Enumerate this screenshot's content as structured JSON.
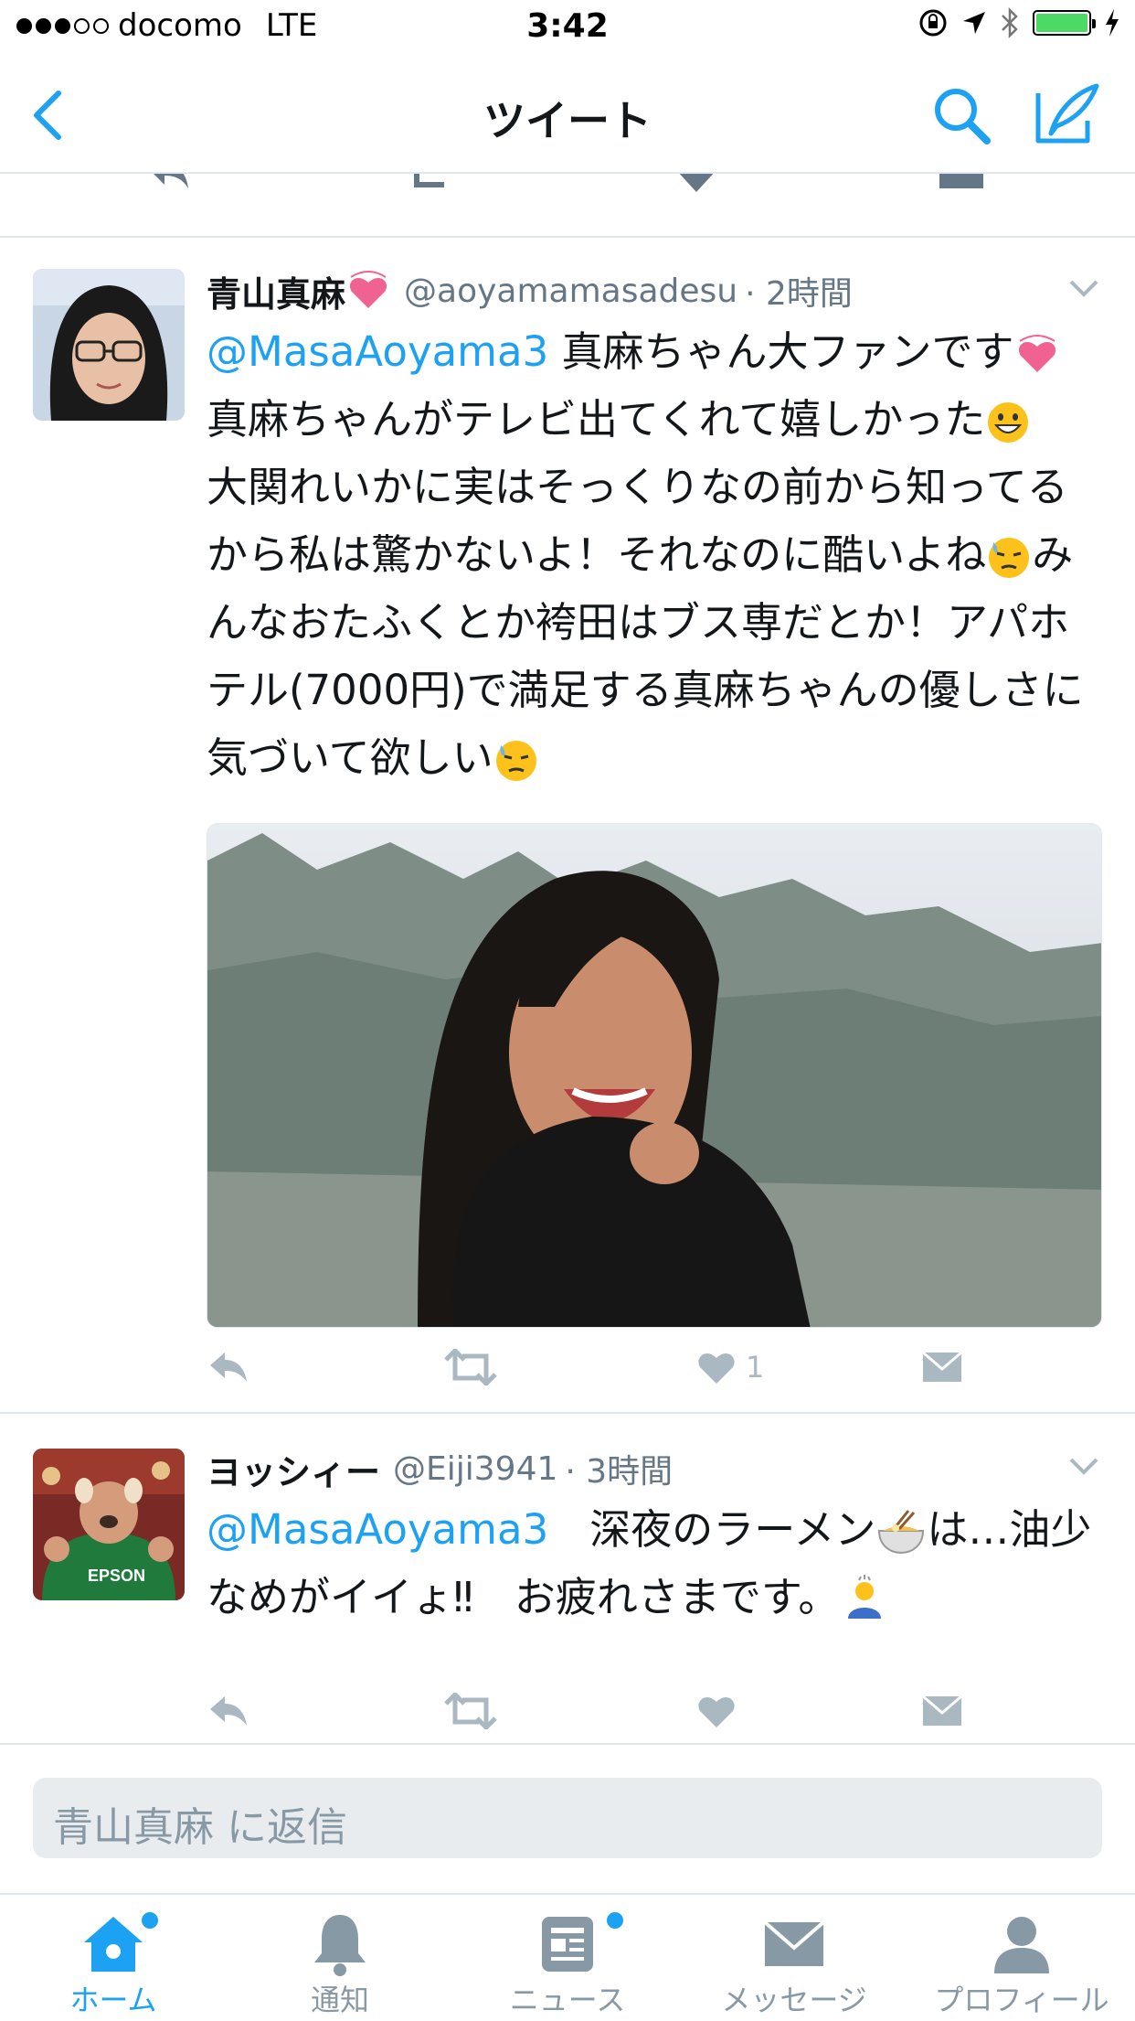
{
  "status_bar": {
    "carrier": "docomo",
    "network": "LTE",
    "time": "3:42"
  },
  "nav": {
    "title": "ツイート"
  },
  "tweets": [
    {
      "name": "青山真麻",
      "handle": "@aoyamamasadesu",
      "time": "· 2時間",
      "mention": "@MasaAoyama3",
      "text_1": " 真麻ちゃん大ファンです",
      "text_2": "真麻ちゃんがテレビ出てくれて嬉しかった",
      "text_3": "大関れいかに実はそっくりなの前から知ってるから私は驚かないよ！それなのに酷いよね",
      "text_4": "みんなおたふくとか袴田はブス専だとか！アパホテル(7000円)で満足する真麻ちゃんの優しさに気づいて欲しい",
      "like_count": "1"
    },
    {
      "name": "ヨッシィー",
      "handle": "@Eiji3941",
      "time": "· 3時間",
      "mention": "@MasaAoyama3",
      "text_1": "　深夜のラーメン",
      "text_2": "は…油少なめがイイょ‼︎　お疲れさまです。",
      "avatar_text": "EPSON"
    }
  ],
  "reply": {
    "placeholder": "青山真麻 に返信"
  },
  "tabs": [
    {
      "label": "ホーム",
      "icon": "home-icon",
      "active": true
    },
    {
      "label": "通知",
      "icon": "bell-icon"
    },
    {
      "label": "ニュース",
      "icon": "news-icon"
    },
    {
      "label": "メッセージ",
      "icon": "envelope-icon"
    },
    {
      "label": "プロフィール",
      "icon": "person-icon"
    }
  ],
  "colors": {
    "accent": "#1da1f2",
    "muted": "#8899a6",
    "action": "#aab8c2",
    "divider": "#e1e8ed"
  }
}
